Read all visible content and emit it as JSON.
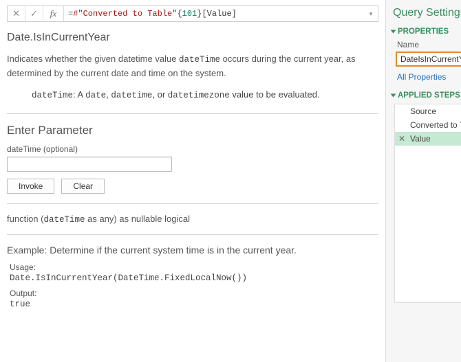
{
  "formula_bar": {
    "eq": "= ",
    "lit1": "#\"Converted to Table\"",
    "brace_open": "{",
    "num": "101",
    "brace_close": "}",
    "field": "[Value]"
  },
  "fn": {
    "title": "Date.IsInCurrentYear",
    "desc_a": "Indicates whether the given datetime value ",
    "desc_code": "dateTime",
    "desc_b": " occurs during the current year, as determined by the current date and time on the system.",
    "param_name": "dateTime",
    "param_desc_a": ": A ",
    "param_t1": "date",
    "param_sep1": ", ",
    "param_t2": "datetime",
    "param_sep2": ", or ",
    "param_t3": "datetimezone",
    "param_desc_b": " value to be evaluated."
  },
  "enter_param": {
    "heading": "Enter Parameter",
    "label": "dateTime (optional)",
    "input_value": "",
    "invoke": "Invoke",
    "clear": "Clear"
  },
  "sig": {
    "a": "function (",
    "p": "dateTime",
    "b": " as any) as nullable logical"
  },
  "example": {
    "head": "Example: Determine if the current system time is in the current year.",
    "usage_label": "Usage:",
    "usage_code": "Date.IsInCurrentYear(DateTime.FixedLocalNow())",
    "output_label": "Output:",
    "output_code": "true"
  },
  "side": {
    "title": "Query Settings",
    "properties": "PROPERTIES",
    "name_label": "Name",
    "name_value": "DateIsInCurrentYear",
    "all_props": "All Properties",
    "applied_steps": "APPLIED STEPS",
    "steps": [
      "Source",
      "Converted to Table",
      "Value"
    ],
    "selected_index": 2
  }
}
